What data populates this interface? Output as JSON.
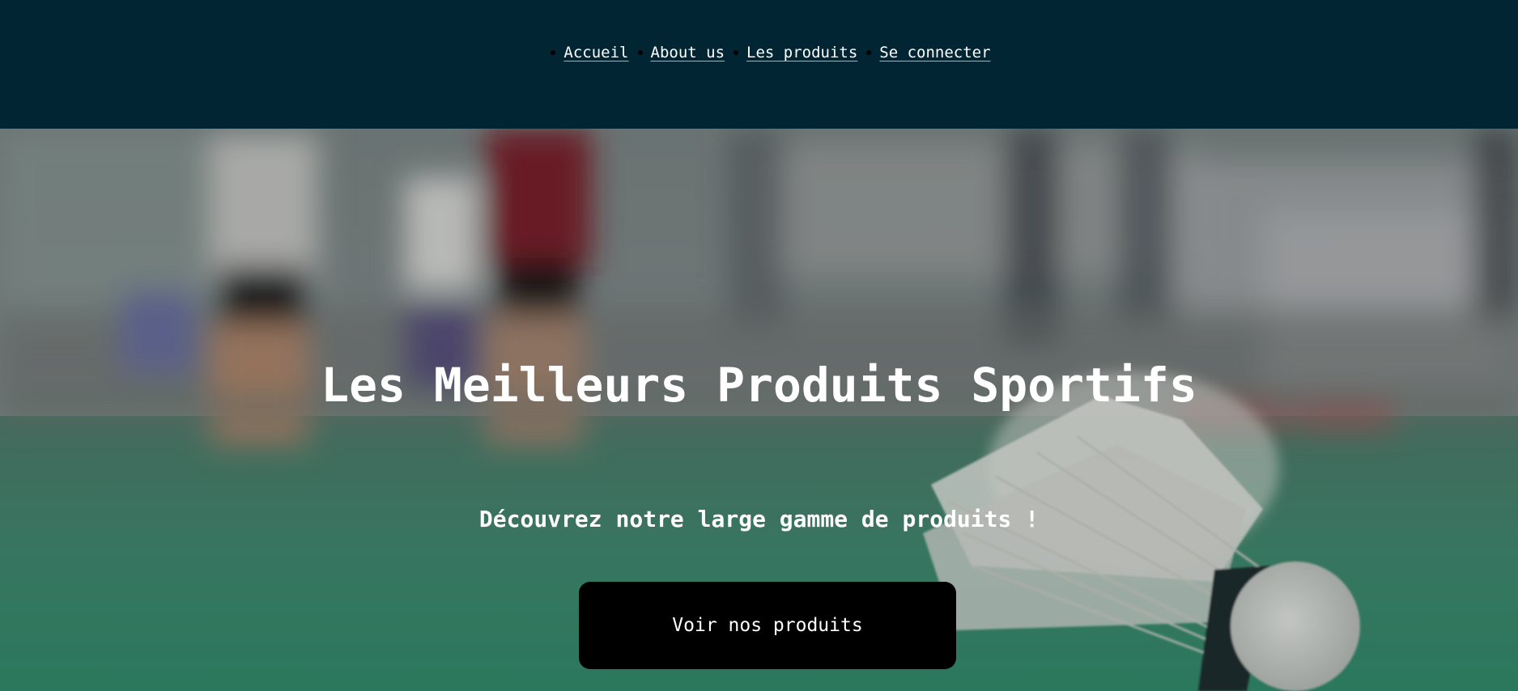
{
  "nav": {
    "items": [
      {
        "label": "Accueil"
      },
      {
        "label": "About us"
      },
      {
        "label": "Les produits"
      },
      {
        "label": "Se connecter"
      }
    ]
  },
  "hero": {
    "title": "Les Meilleurs Produits Sportifs",
    "subtitle": "Découvrez notre large gamme de produits !",
    "cta_label": "Voir nos produits",
    "image_description": "blurred badminton court with a shuttlecock in the foreground"
  },
  "colors": {
    "nav_background": "#012533",
    "cta_background": "#000000",
    "text": "#ffffff"
  }
}
